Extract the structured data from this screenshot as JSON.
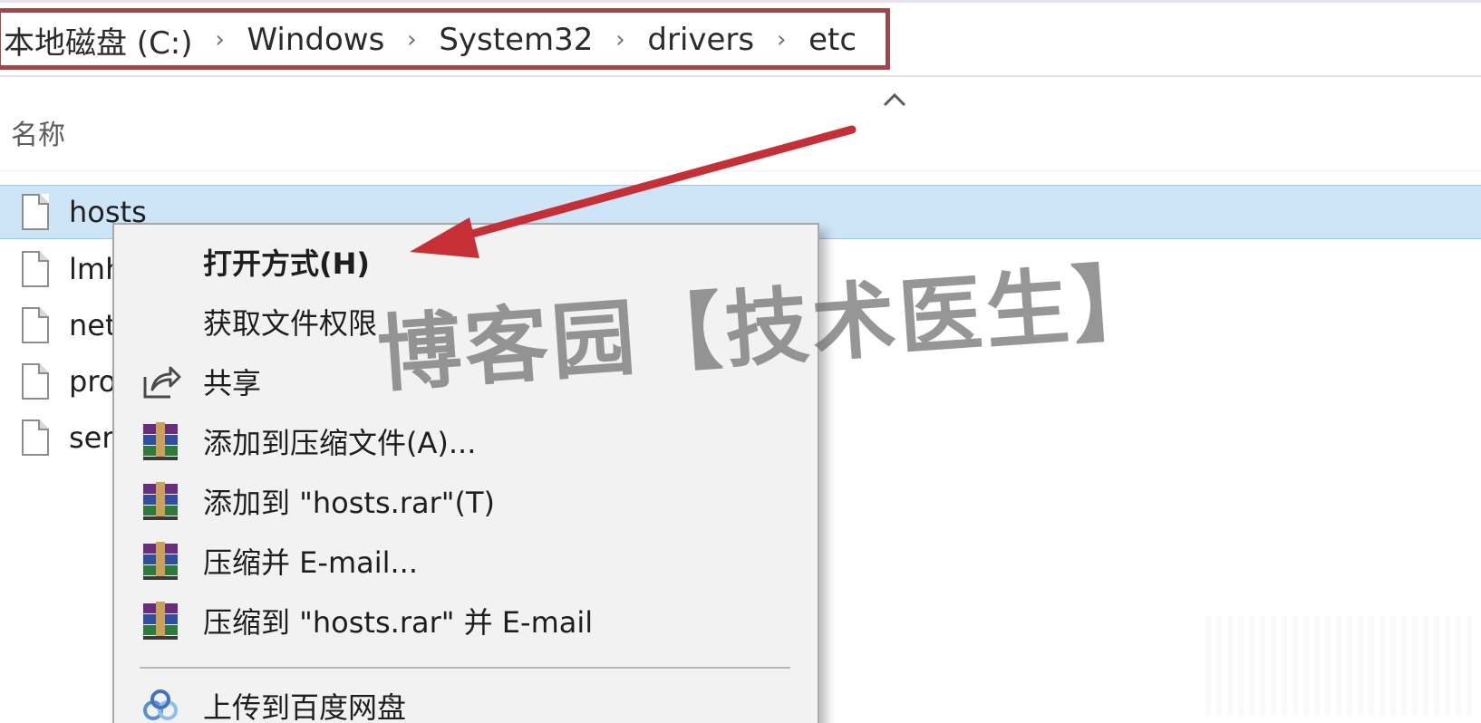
{
  "breadcrumb": {
    "items": [
      "本地磁盘 (C:)",
      "Windows",
      "System32",
      "drivers",
      "etc"
    ],
    "separator": "›"
  },
  "column_header": {
    "name_label": "名称",
    "sort_icon": "chevron-up-icon"
  },
  "files": [
    {
      "name": "hosts",
      "selected": true,
      "icon": "file-icon"
    },
    {
      "name": "lmh",
      "selected": false,
      "icon": "file-icon"
    },
    {
      "name": "net",
      "selected": false,
      "icon": "file-icon"
    },
    {
      "name": "pro",
      "selected": false,
      "icon": "file-icon"
    },
    {
      "name": "ser",
      "selected": false,
      "icon": "file-icon"
    }
  ],
  "context_menu": {
    "items": [
      {
        "label": "打开方式(H)",
        "icon": "",
        "bold": true
      },
      {
        "label": "获取文件权限",
        "icon": ""
      },
      {
        "label": "共享",
        "icon": "share-icon"
      },
      {
        "label": "添加到压缩文件(A)...",
        "icon": "winrar-icon"
      },
      {
        "label": "添加到 \"hosts.rar\"(T)",
        "icon": "winrar-icon"
      },
      {
        "label": "压缩并 E-mail...",
        "icon": "winrar-icon"
      },
      {
        "label": "压缩到 \"hosts.rar\" 并 E-mail",
        "icon": "winrar-icon"
      },
      {
        "label": "上传到百度网盘",
        "icon": "baidu-netdisk-icon"
      }
    ]
  },
  "watermark": "博客园【技术医生】",
  "colors": {
    "selection_bg": "#cde5f7",
    "highlight_frame": "#a3464a",
    "annotation_arrow": "#c62f35",
    "menu_bg": "#f2f2f2"
  }
}
